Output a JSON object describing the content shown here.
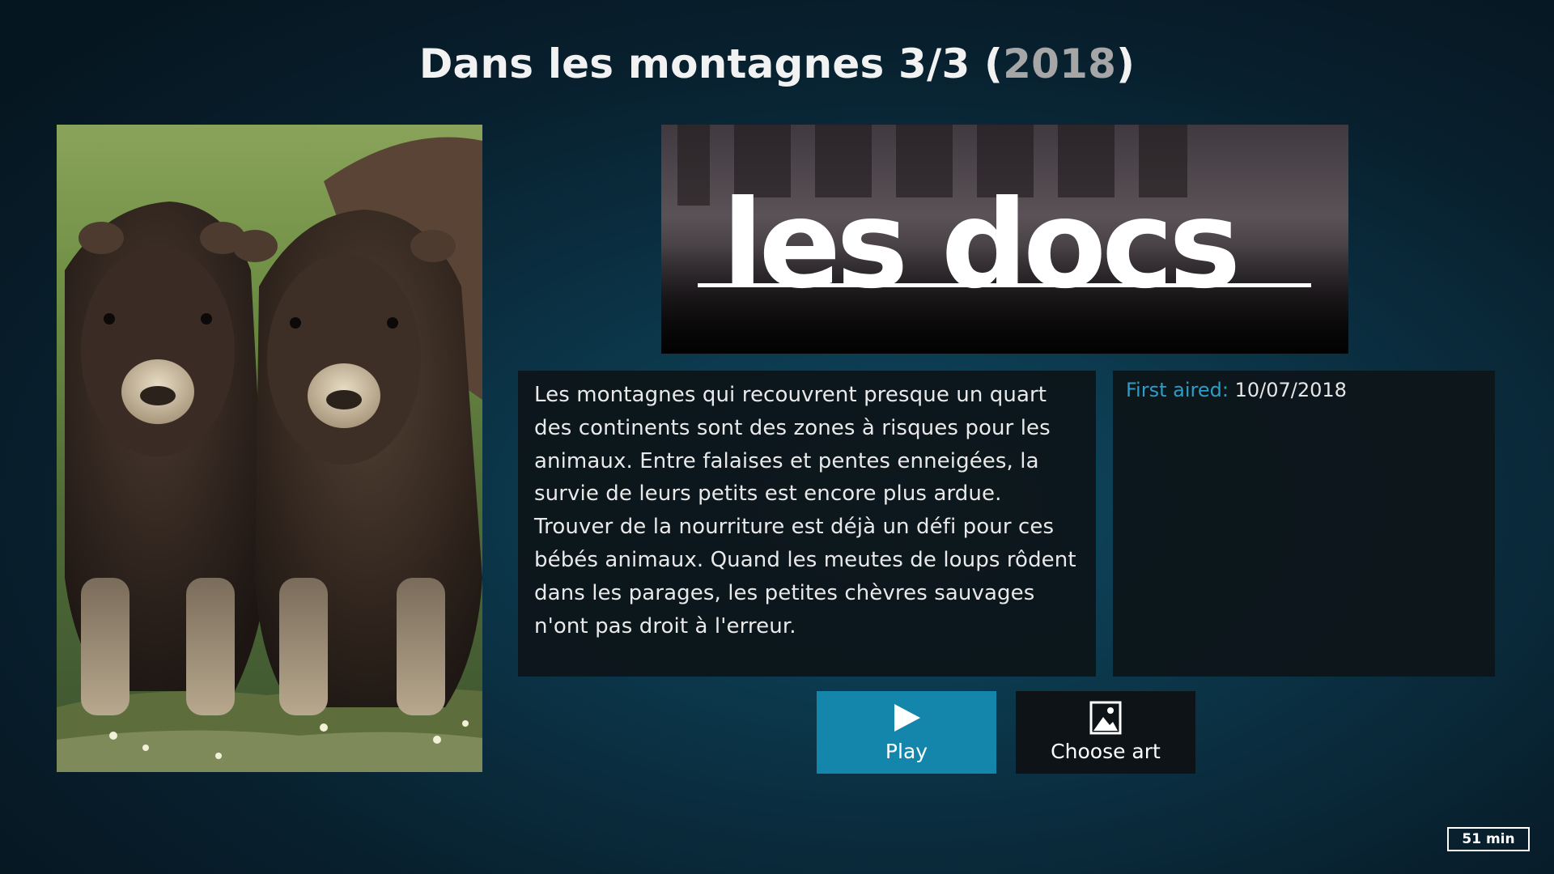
{
  "header": {
    "title": "Dans les montagnes 3/3",
    "year": "2018"
  },
  "poster": {
    "description_icon": "musk-ox-calves-poster"
  },
  "logo": {
    "text": "les docs"
  },
  "plot": {
    "text": "Les montagnes qui recouvrent presque un quart des continents sont des zones à risques pour les animaux. Entre falaises et pentes enneigées, la survie de leurs petits est encore plus ardue. Trouver de la nourriture est déjà un défi pour ces bébés animaux. Quand les meutes de loups rôdent dans les parages, les petites chèvres sauvages n'ont pas droit à l'erreur."
  },
  "info": {
    "first_aired_label": "First aired:",
    "first_aired_value": "10/07/2018"
  },
  "buttons": {
    "play_label": "Play",
    "play_icon": "play-icon",
    "choose_art_label": "Choose art",
    "choose_art_icon": "image-icon"
  },
  "footer": {
    "duration": "51 min"
  },
  "colors": {
    "accent": "#1486ab",
    "label_blue": "#2f9bc7"
  }
}
